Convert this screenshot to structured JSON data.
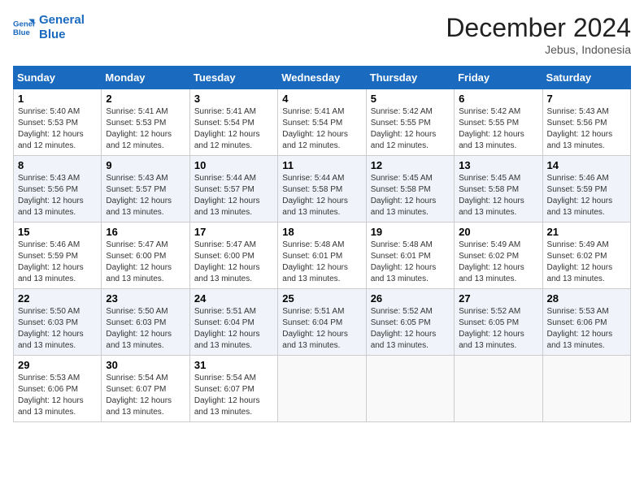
{
  "logo": {
    "line1": "General",
    "line2": "Blue"
  },
  "title": "December 2024",
  "subtitle": "Jebus, Indonesia",
  "days_of_week": [
    "Sunday",
    "Monday",
    "Tuesday",
    "Wednesday",
    "Thursday",
    "Friday",
    "Saturday"
  ],
  "weeks": [
    [
      {
        "day": "1",
        "sunrise": "5:40 AM",
        "sunset": "5:53 PM",
        "daylight": "12 hours and 12 minutes."
      },
      {
        "day": "2",
        "sunrise": "5:41 AM",
        "sunset": "5:53 PM",
        "daylight": "12 hours and 12 minutes."
      },
      {
        "day": "3",
        "sunrise": "5:41 AM",
        "sunset": "5:54 PM",
        "daylight": "12 hours and 12 minutes."
      },
      {
        "day": "4",
        "sunrise": "5:41 AM",
        "sunset": "5:54 PM",
        "daylight": "12 hours and 12 minutes."
      },
      {
        "day": "5",
        "sunrise": "5:42 AM",
        "sunset": "5:55 PM",
        "daylight": "12 hours and 12 minutes."
      },
      {
        "day": "6",
        "sunrise": "5:42 AM",
        "sunset": "5:55 PM",
        "daylight": "12 hours and 13 minutes."
      },
      {
        "day": "7",
        "sunrise": "5:43 AM",
        "sunset": "5:56 PM",
        "daylight": "12 hours and 13 minutes."
      }
    ],
    [
      {
        "day": "8",
        "sunrise": "5:43 AM",
        "sunset": "5:56 PM",
        "daylight": "12 hours and 13 minutes."
      },
      {
        "day": "9",
        "sunrise": "5:43 AM",
        "sunset": "5:57 PM",
        "daylight": "12 hours and 13 minutes."
      },
      {
        "day": "10",
        "sunrise": "5:44 AM",
        "sunset": "5:57 PM",
        "daylight": "12 hours and 13 minutes."
      },
      {
        "day": "11",
        "sunrise": "5:44 AM",
        "sunset": "5:58 PM",
        "daylight": "12 hours and 13 minutes."
      },
      {
        "day": "12",
        "sunrise": "5:45 AM",
        "sunset": "5:58 PM",
        "daylight": "12 hours and 13 minutes."
      },
      {
        "day": "13",
        "sunrise": "5:45 AM",
        "sunset": "5:58 PM",
        "daylight": "12 hours and 13 minutes."
      },
      {
        "day": "14",
        "sunrise": "5:46 AM",
        "sunset": "5:59 PM",
        "daylight": "12 hours and 13 minutes."
      }
    ],
    [
      {
        "day": "15",
        "sunrise": "5:46 AM",
        "sunset": "5:59 PM",
        "daylight": "12 hours and 13 minutes."
      },
      {
        "day": "16",
        "sunrise": "5:47 AM",
        "sunset": "6:00 PM",
        "daylight": "12 hours and 13 minutes."
      },
      {
        "day": "17",
        "sunrise": "5:47 AM",
        "sunset": "6:00 PM",
        "daylight": "12 hours and 13 minutes."
      },
      {
        "day": "18",
        "sunrise": "5:48 AM",
        "sunset": "6:01 PM",
        "daylight": "12 hours and 13 minutes."
      },
      {
        "day": "19",
        "sunrise": "5:48 AM",
        "sunset": "6:01 PM",
        "daylight": "12 hours and 13 minutes."
      },
      {
        "day": "20",
        "sunrise": "5:49 AM",
        "sunset": "6:02 PM",
        "daylight": "12 hours and 13 minutes."
      },
      {
        "day": "21",
        "sunrise": "5:49 AM",
        "sunset": "6:02 PM",
        "daylight": "12 hours and 13 minutes."
      }
    ],
    [
      {
        "day": "22",
        "sunrise": "5:50 AM",
        "sunset": "6:03 PM",
        "daylight": "12 hours and 13 minutes."
      },
      {
        "day": "23",
        "sunrise": "5:50 AM",
        "sunset": "6:03 PM",
        "daylight": "12 hours and 13 minutes."
      },
      {
        "day": "24",
        "sunrise": "5:51 AM",
        "sunset": "6:04 PM",
        "daylight": "12 hours and 13 minutes."
      },
      {
        "day": "25",
        "sunrise": "5:51 AM",
        "sunset": "6:04 PM",
        "daylight": "12 hours and 13 minutes."
      },
      {
        "day": "26",
        "sunrise": "5:52 AM",
        "sunset": "6:05 PM",
        "daylight": "12 hours and 13 minutes."
      },
      {
        "day": "27",
        "sunrise": "5:52 AM",
        "sunset": "6:05 PM",
        "daylight": "12 hours and 13 minutes."
      },
      {
        "day": "28",
        "sunrise": "5:53 AM",
        "sunset": "6:06 PM",
        "daylight": "12 hours and 13 minutes."
      }
    ],
    [
      {
        "day": "29",
        "sunrise": "5:53 AM",
        "sunset": "6:06 PM",
        "daylight": "12 hours and 13 minutes."
      },
      {
        "day": "30",
        "sunrise": "5:54 AM",
        "sunset": "6:07 PM",
        "daylight": "12 hours and 13 minutes."
      },
      {
        "day": "31",
        "sunrise": "5:54 AM",
        "sunset": "6:07 PM",
        "daylight": "12 hours and 13 minutes."
      },
      null,
      null,
      null,
      null
    ]
  ],
  "labels": {
    "sunrise_prefix": "Sunrise: ",
    "sunset_prefix": "Sunset: ",
    "daylight_label": "Daylight: "
  }
}
